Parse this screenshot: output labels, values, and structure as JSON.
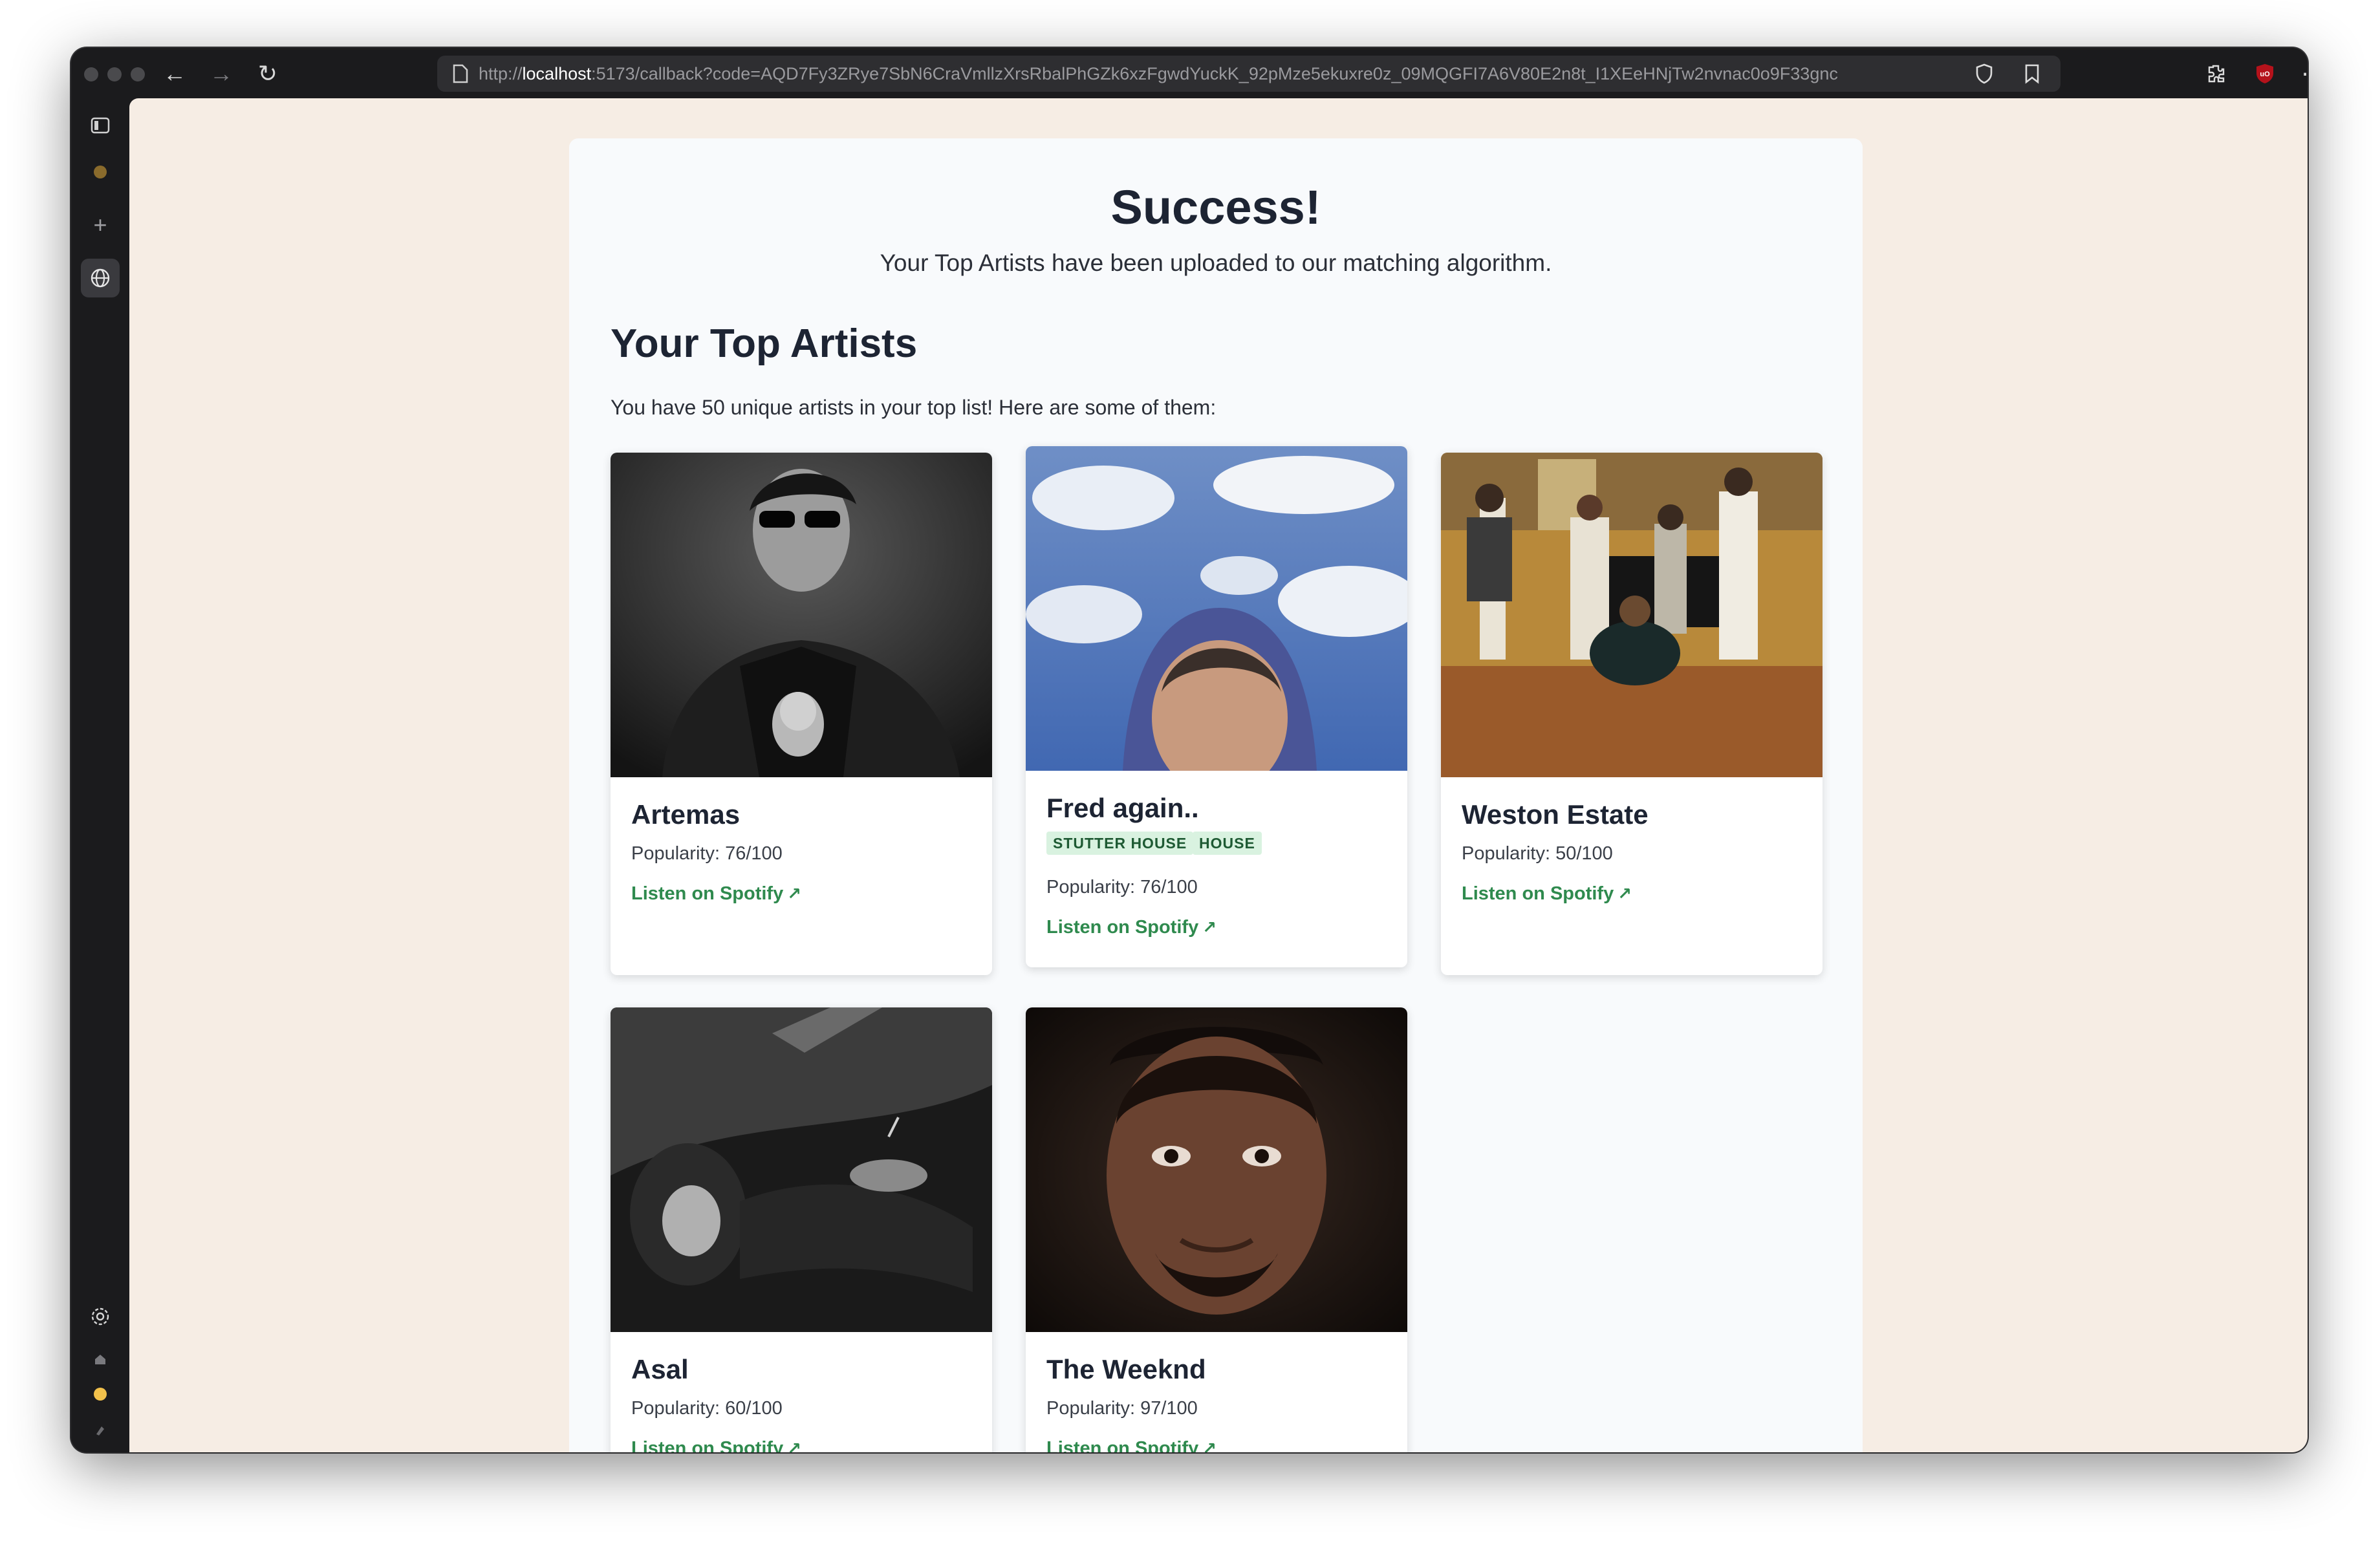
{
  "browser": {
    "url_host": "localhost",
    "url_prefix": "http://",
    "url_rest": ":5173/callback?code=AQD7Fy3ZRye7SbN6CraVmllzXrsRbalPhGZk6xzFgwdYuckK_92pMze5ekuxre0z_09MQGFI7A6V80E2n8t_I1XEeHNjTw2nvnac0o9F33gnc",
    "back_icon": "←",
    "forward_icon": "→",
    "reload_icon": "↻",
    "menu_icon": "⋯"
  },
  "page": {
    "title": "Success!",
    "subtitle": "Your Top Artists have been uploaded to our matching algorithm.",
    "section_title": "Your Top Artists",
    "section_sub": "You have 50 unique artists in your top list! Here are some of them:"
  },
  "artists": [
    {
      "name": "Artemas",
      "popularity": "Popularity: 76/100",
      "link": "Listen on Spotify",
      "genres": []
    },
    {
      "name": "Fred again..",
      "popularity": "Popularity: 76/100",
      "link": "Listen on Spotify",
      "genres": [
        "STUTTER HOUSE",
        "HOUSE"
      ]
    },
    {
      "name": "Weston Estate",
      "popularity": "Popularity: 50/100",
      "link": "Listen on Spotify",
      "genres": []
    },
    {
      "name": "Asal",
      "popularity": "Popularity: 60/100",
      "link": "Listen on Spotify",
      "genres": []
    },
    {
      "name": "The Weeknd",
      "popularity": "Popularity: 97/100",
      "link": "Listen on Spotify",
      "genres": []
    }
  ],
  "colors": {
    "page_background": "#f6ede4",
    "card_background": "#f8fafc",
    "link": "#2f8a4e",
    "genre_badge": "#d9f2e0"
  }
}
